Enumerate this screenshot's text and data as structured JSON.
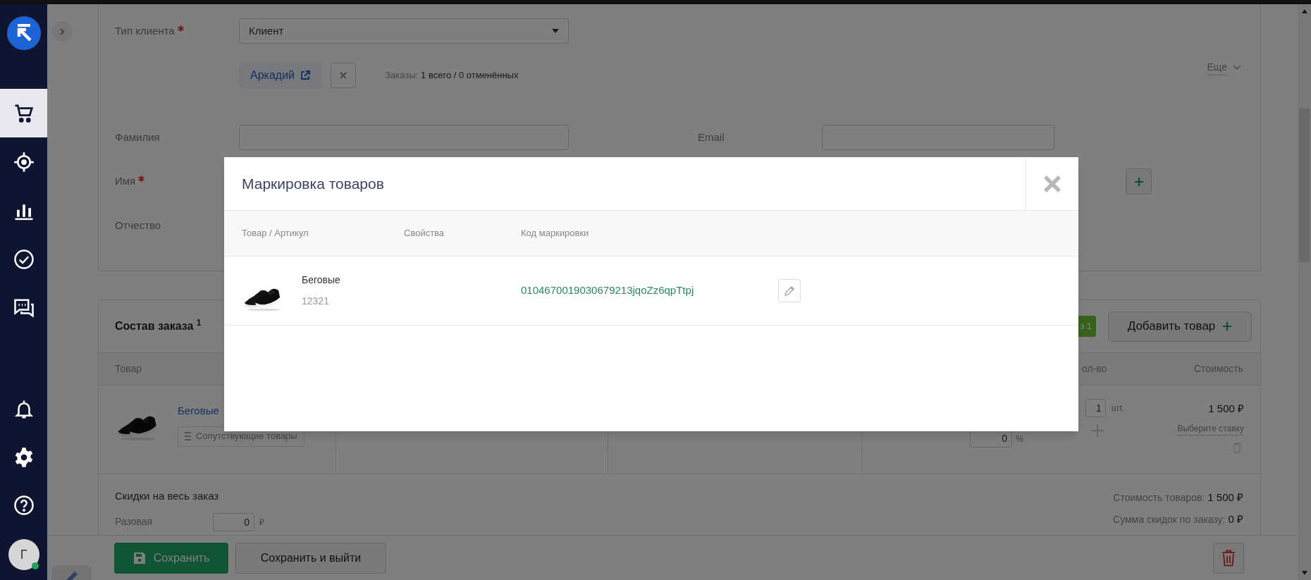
{
  "sidebar": {
    "items": [
      {
        "kind": "cart",
        "selected": true
      },
      {
        "kind": "target",
        "selected": false
      },
      {
        "kind": "chart",
        "selected": false
      },
      {
        "kind": "check",
        "selected": false
      },
      {
        "kind": "chat",
        "selected": false
      }
    ],
    "bottom_items": [
      {
        "kind": "bell"
      },
      {
        "kind": "gear"
      },
      {
        "kind": "help"
      }
    ],
    "avatar": {
      "initial": "Г",
      "online": true
    }
  },
  "customer_form": {
    "client_type": {
      "label": "Тип клиента",
      "required": true,
      "value": "Клиент"
    },
    "customer_chip": "Аркадий",
    "orders_label": "Заказы:",
    "orders_value": "1 всего / 0 отменённых",
    "more_link": "Еще",
    "fields": [
      {
        "label": "Фамилия",
        "required": false
      },
      {
        "label": "Email",
        "required": false
      },
      {
        "label": "Имя",
        "required": true
      },
      {
        "label": "Отчество",
        "required": false
      }
    ]
  },
  "order_items": {
    "title": "Состав заказа $^{1}$",
    "badge": "з 1",
    "add_button": "Добавить товар",
    "columns": [
      "Товар",
      "ол-во",
      "Стоимость"
    ],
    "rows": [
      {
        "name": "Беговые",
        "related_button": "Сопутствующие товары",
        "discount": "0",
        "discount_unit": "%",
        "quantity": "1",
        "unit": "шт.",
        "price": "1 500 ₽",
        "vat_link": "Выберите ставку"
      }
    ]
  },
  "order_discounts": {
    "title": "Скидки на весь заказ",
    "one_time_label": "Разовая",
    "one_time_value": "0",
    "one_time_unit": "₽",
    "totals": [
      {
        "label": "Стоимость товаров:",
        "value": "1 500 ₽"
      },
      {
        "label": "Сумма скидок по заказу:",
        "value": "0 ₽"
      }
    ]
  },
  "actions": {
    "save": "Сохранить",
    "save_and_exit": "Сохранить и выйти"
  },
  "modal": {
    "title": "Маркировка товаров",
    "columns": [
      "Товар / Артикул",
      "Свойства",
      "Код маркировки"
    ],
    "rows": [
      {
        "name": "Беговые",
        "sku": "12321",
        "code": "0104670019030679213jqoZz6qpTtpj"
      }
    ]
  }
}
